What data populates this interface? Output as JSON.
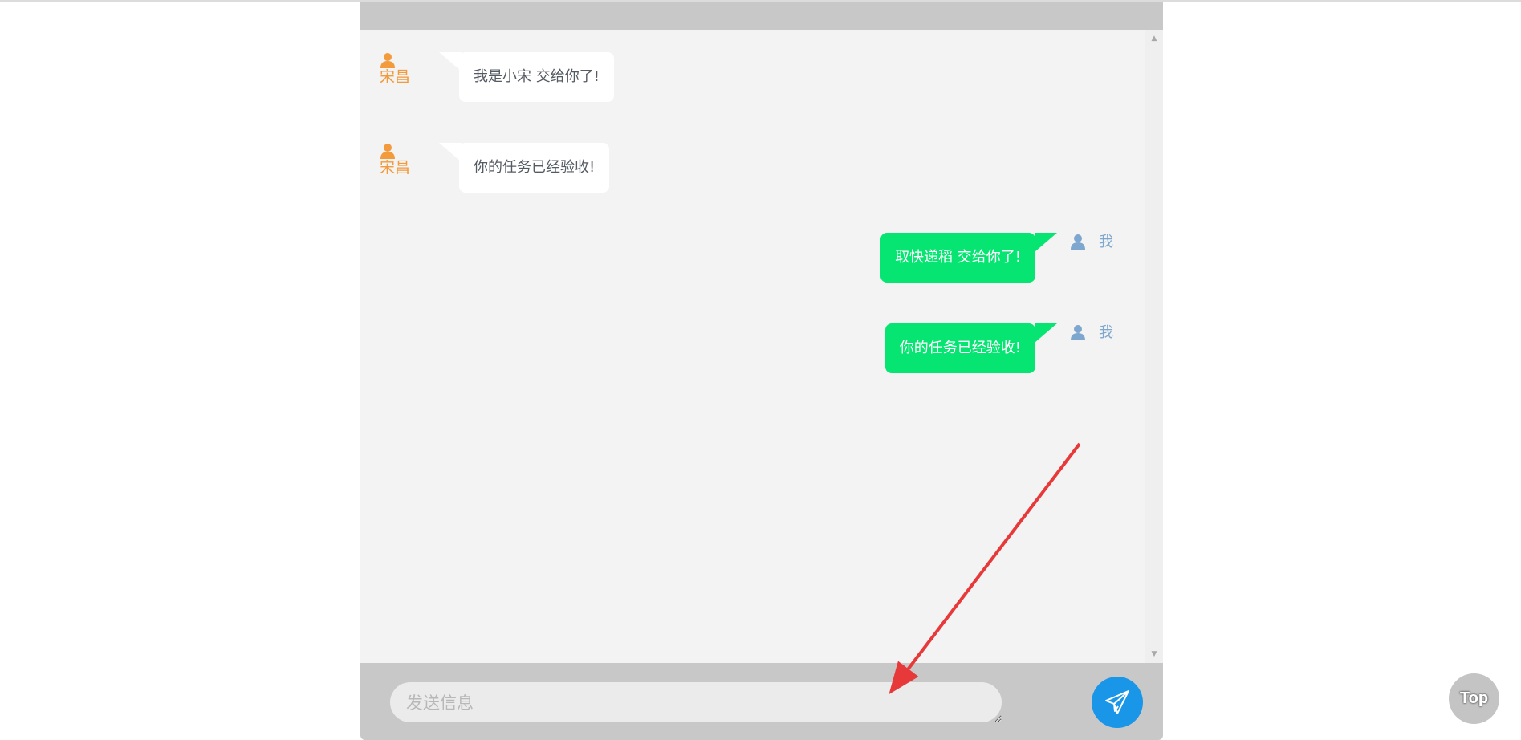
{
  "chat": {
    "messages": [
      {
        "direction": "incoming",
        "sender": "宋昌",
        "text": "我是小宋 交给你了!"
      },
      {
        "direction": "incoming",
        "sender": "宋昌",
        "text": "你的任务已经验收!"
      },
      {
        "direction": "outgoing",
        "sender": "我",
        "text": "取快递稻 交给你了!"
      },
      {
        "direction": "outgoing",
        "sender": "我",
        "text": "你的任务已经验收!"
      }
    ]
  },
  "composer": {
    "placeholder": "发送信息",
    "value": ""
  },
  "icons": {
    "send": "paper-plane-icon",
    "avatar": "user-icon"
  },
  "back_to_top": {
    "label": "Top"
  },
  "colors": {
    "incoming_name": "#f39a3c",
    "outgoing_bubble": "#06e572",
    "outgoing_name": "#7ea7cf",
    "send_button": "#1a96e8",
    "annotation_arrow": "#e8393a"
  }
}
